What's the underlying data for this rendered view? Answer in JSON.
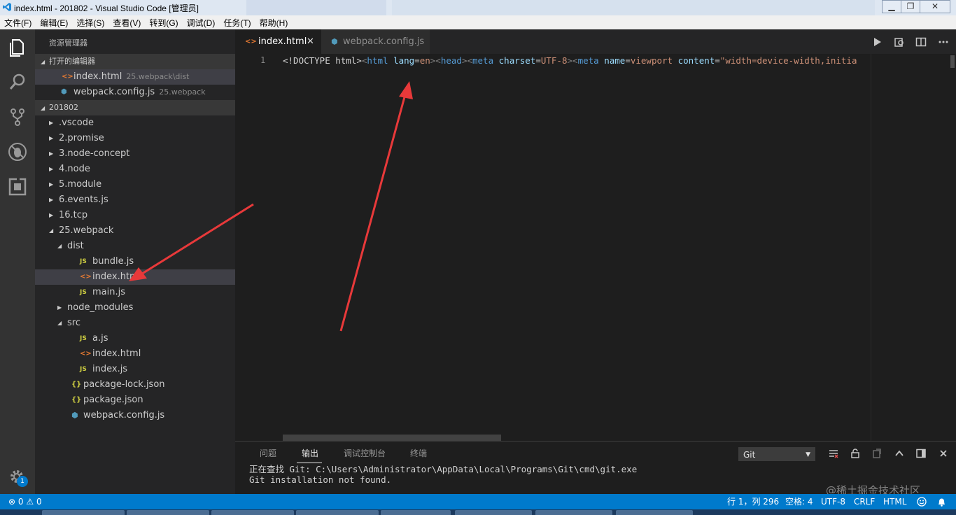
{
  "window": {
    "title": "index.html - 201802 - Visual Studio Code [管理员]",
    "minimize_glyph": "▁",
    "maximize_glyph": "❐",
    "close_glyph": "✕"
  },
  "menu": [
    "文件(F)",
    "编辑(E)",
    "选择(S)",
    "查看(V)",
    "转到(G)",
    "调试(D)",
    "任务(T)",
    "帮助(H)"
  ],
  "activity_bar": {
    "icons": [
      "explorer-icon",
      "search-icon",
      "source-control-icon",
      "debug-icon",
      "extensions-icon"
    ],
    "settings_badge": "1"
  },
  "sidebar": {
    "title": "资源管理器",
    "open_editors": {
      "header": "打开的编辑器",
      "items": [
        {
          "name": "index.html",
          "desc": "25.webpack\\dist",
          "icon": "html-icon"
        },
        {
          "name": "webpack.config.js",
          "desc": "25.webpack",
          "icon": "webpack-icon"
        }
      ]
    },
    "folder": {
      "header": "201802",
      "items": [
        {
          "name": ".vscode",
          "type": "folder",
          "expanded": false,
          "depth": 0
        },
        {
          "name": "2.promise",
          "type": "folder",
          "expanded": false,
          "depth": 0
        },
        {
          "name": "3.node-concept",
          "type": "folder",
          "expanded": false,
          "depth": 0
        },
        {
          "name": "4.node",
          "type": "folder",
          "expanded": false,
          "depth": 0
        },
        {
          "name": "5.module",
          "type": "folder",
          "expanded": false,
          "depth": 0
        },
        {
          "name": "6.events.js",
          "type": "folder",
          "expanded": false,
          "depth": 0
        },
        {
          "name": "16.tcp",
          "type": "folder",
          "expanded": false,
          "depth": 0
        },
        {
          "name": "25.webpack",
          "type": "folder",
          "expanded": true,
          "depth": 0
        },
        {
          "name": "dist",
          "type": "folder",
          "expanded": true,
          "depth": 1
        },
        {
          "name": "bundle.js",
          "type": "js",
          "depth": 2
        },
        {
          "name": "index.html",
          "type": "html",
          "depth": 2,
          "selected": true
        },
        {
          "name": "main.js",
          "type": "js",
          "depth": 2
        },
        {
          "name": "node_modules",
          "type": "folder",
          "expanded": false,
          "depth": 1
        },
        {
          "name": "src",
          "type": "folder",
          "expanded": true,
          "depth": 1
        },
        {
          "name": "a.js",
          "type": "js",
          "depth": 2
        },
        {
          "name": "index.html",
          "type": "html",
          "depth": 2
        },
        {
          "name": "index.js",
          "type": "js",
          "depth": 2
        },
        {
          "name": "package-lock.json",
          "type": "json",
          "depth": 1
        },
        {
          "name": "package.json",
          "type": "json",
          "depth": 1
        },
        {
          "name": "webpack.config.js",
          "type": "webpack",
          "depth": 1
        }
      ]
    }
  },
  "tabs": [
    {
      "label": "index.html",
      "active": true,
      "icon": "html-icon",
      "close": "✕"
    },
    {
      "label": "webpack.config.js",
      "active": false,
      "icon": "webpack-icon"
    }
  ],
  "tab_actions": [
    "run-icon",
    "open-changes-icon",
    "split-editor-icon",
    "more-icon"
  ],
  "editor": {
    "line_number": "1",
    "tokens": [
      {
        "t": "<!DOCTYPE html>",
        "c": "txt"
      },
      {
        "t": "<",
        "c": "brk"
      },
      {
        "t": "html",
        "c": "tag"
      },
      {
        "t": " ",
        "c": "txt"
      },
      {
        "t": "lang",
        "c": "attr"
      },
      {
        "t": "=",
        "c": "txt"
      },
      {
        "t": "en",
        "c": "str"
      },
      {
        "t": ">",
        "c": "brk"
      },
      {
        "t": "<",
        "c": "brk"
      },
      {
        "t": "head",
        "c": "tag"
      },
      {
        "t": ">",
        "c": "brk"
      },
      {
        "t": "<",
        "c": "brk"
      },
      {
        "t": "meta",
        "c": "tag"
      },
      {
        "t": " ",
        "c": "txt"
      },
      {
        "t": "charset",
        "c": "attr"
      },
      {
        "t": "=",
        "c": "txt"
      },
      {
        "t": "UTF-8",
        "c": "str"
      },
      {
        "t": ">",
        "c": "brk"
      },
      {
        "t": "<",
        "c": "brk"
      },
      {
        "t": "meta",
        "c": "tag"
      },
      {
        "t": " ",
        "c": "txt"
      },
      {
        "t": "name",
        "c": "attr"
      },
      {
        "t": "=",
        "c": "txt"
      },
      {
        "t": "viewport",
        "c": "str"
      },
      {
        "t": " ",
        "c": "txt"
      },
      {
        "t": "content",
        "c": "attr"
      },
      {
        "t": "=",
        "c": "txt"
      },
      {
        "t": "\"width=device-width,initia",
        "c": "str"
      }
    ]
  },
  "panel": {
    "tabs": [
      "问题",
      "输出",
      "调试控制台",
      "终端"
    ],
    "active_tab": "输出",
    "channel": "Git",
    "channel_arrow": "▼",
    "output_lines": [
      "正在查找 Git: C:\\Users\\Administrator\\AppData\\Local\\Programs\\Git\\cmd\\git.exe",
      "Git installation not found."
    ],
    "actions": [
      "clear-output-icon",
      "lock-scroll-icon",
      "open-log-icon",
      "maximize-panel-icon",
      "toggle-panel-icon",
      "close-panel-icon"
    ]
  },
  "status": {
    "errors": "0",
    "warnings": "0",
    "position": "行 1，列 296",
    "indent": "空格: 4",
    "encoding": "UTF-8",
    "eol": "CRLF",
    "language": "HTML",
    "feedback_icon": "smiley-icon",
    "bell_icon": "bell-icon"
  },
  "watermark": "@稀土掘金技术社区",
  "colors": {
    "accent": "#007acc",
    "annotation_arrow": "#e8393a"
  }
}
